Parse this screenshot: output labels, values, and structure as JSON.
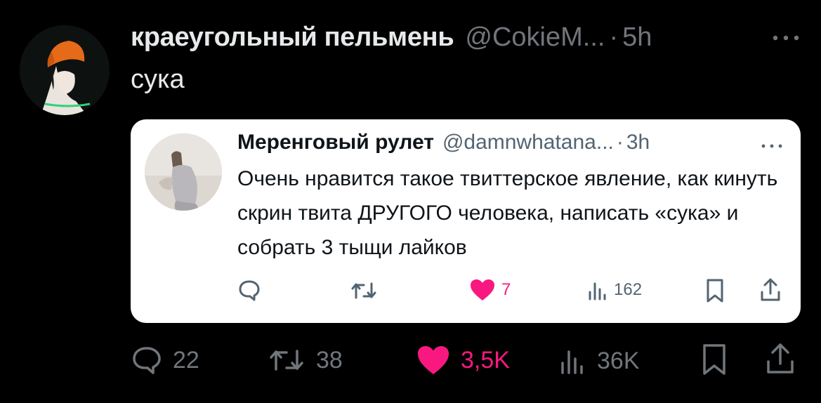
{
  "tweet": {
    "author_name": "краеугольный пельмень",
    "handle": "@CokieM...",
    "separator": "·",
    "time": "5h",
    "text": "сука",
    "actions": {
      "replies": "22",
      "retweets": "38",
      "likes": "3,5K",
      "views": "36K"
    }
  },
  "quoted_tweet": {
    "author_name": "Меренговый рулет",
    "handle": "@damnwhatana...",
    "separator": "·",
    "time": "3h",
    "text": "Очень нравится такое твиттерское явление, как кинуть скрин твита ДРУГОГО человека, написать «сука» и собрать 3 тыщи лайков",
    "actions": {
      "likes": "7",
      "views": "162"
    }
  },
  "colors": {
    "background": "#000000",
    "card_background": "#ffffff",
    "like_pink": "#f91880",
    "muted_gray": "#71767b",
    "text_light": "#e7e9ea"
  },
  "icons": [
    "more-icon",
    "reply-icon",
    "retweet-icon",
    "heart-icon",
    "views-icon",
    "bookmark-icon",
    "share-icon"
  ]
}
